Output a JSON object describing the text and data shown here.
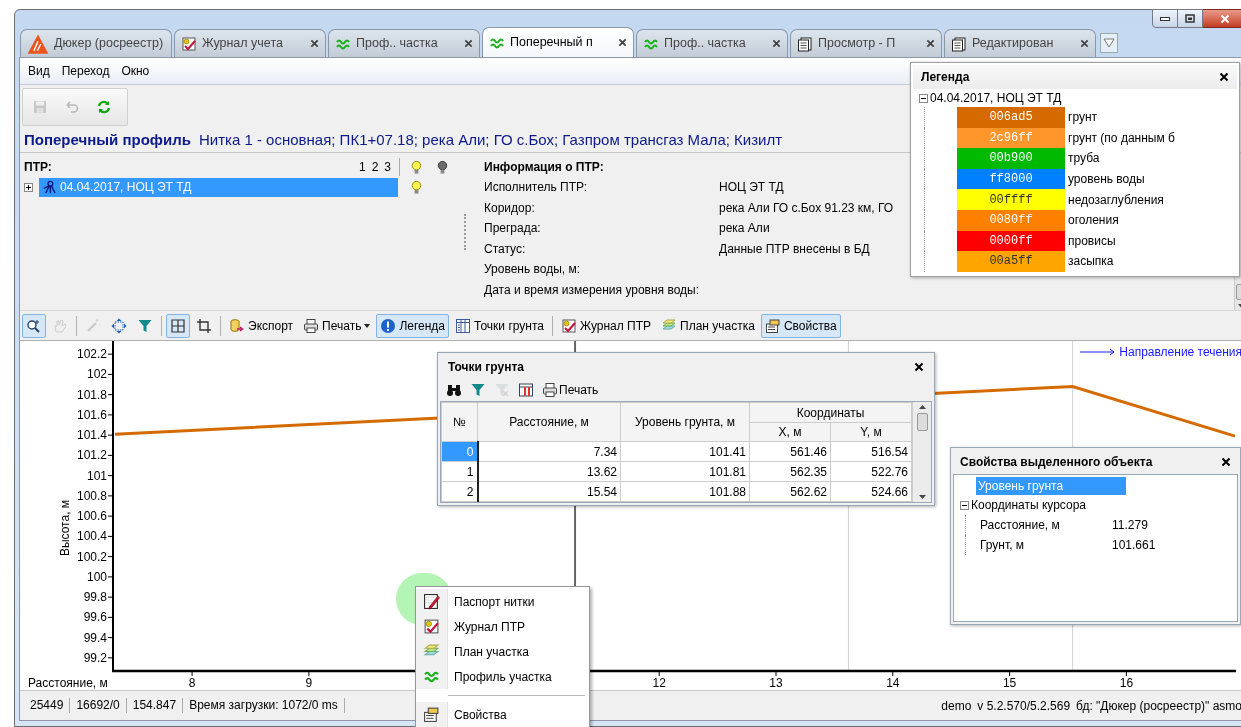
{
  "tabs": [
    {
      "label": "Дюкер (росреестр)",
      "kind": "logo",
      "closable": false,
      "selected": false
    },
    {
      "label": "Журнал учета",
      "kind": "journal",
      "closable": true,
      "selected": false
    },
    {
      "label": "Проф.. частка",
      "kind": "profile",
      "closable": true,
      "selected": false
    },
    {
      "label": "Поперечный п",
      "kind": "profile",
      "closable": true,
      "selected": true
    },
    {
      "label": "Проф.. частка",
      "kind": "profile",
      "closable": true,
      "selected": false
    },
    {
      "label": "Просмотр - П",
      "kind": "document",
      "closable": true,
      "selected": false
    },
    {
      "label": "Редактирован",
      "kind": "document",
      "closable": true,
      "selected": false
    }
  ],
  "menu": [
    "Вид",
    "Переход",
    "Окно"
  ],
  "toolbar": [
    {
      "disabled": true
    },
    {
      "disabled": true
    },
    {
      "disabled": false
    }
  ],
  "heading": {
    "title": "Поперечный профиль",
    "details": "Нитка 1 - основная; ПК1+07.18; река Али; ГО с.Бох; Газпром трансгаз Мала; Кизилт"
  },
  "ptr": {
    "label": "ПТР:",
    "levels": [
      "1",
      "2",
      "3"
    ],
    "tree": [
      {
        "label": "04.04.2017, НОЦ ЭТ ТД",
        "expanded": false,
        "selected": true,
        "visible": true
      }
    ]
  },
  "info": {
    "title": "Информация о ПТР:",
    "rows": [
      {
        "label": "Исполнитель ПТР:",
        "value": "НОЦ ЭТ ТД"
      },
      {
        "label": "Коридор:",
        "value": "река Али ГО с.Бох 91.23 км, ГО"
      },
      {
        "label": "Преграда:",
        "value": "река Али"
      },
      {
        "label": "Статус:",
        "value": "Данные ПТР внесены в БД"
      },
      {
        "label": "Уровень воды, м:"
      },
      {
        "label": "Дата и время измерения уровня воды:"
      }
    ]
  },
  "chart_toolbar": [
    {
      "kind": "button",
      "pressed": true,
      "disabled": false
    },
    {
      "kind": "button",
      "pressed": false,
      "disabled": true
    },
    {
      "kind": "separator"
    },
    {
      "kind": "button",
      "pressed": false,
      "disabled": true
    },
    {
      "kind": "button",
      "pressed": false,
      "disabled": false
    },
    {
      "kind": "button",
      "pressed": false,
      "disabled": false
    },
    {
      "kind": "separator"
    },
    {
      "kind": "button",
      "pressed": true,
      "disabled": false
    },
    {
      "kind": "button",
      "pressed": false,
      "disabled": false
    },
    {
      "kind": "separator"
    },
    {
      "kind": "button",
      "label": "Экспорт",
      "pressed": false,
      "disabled": false
    },
    {
      "kind": "dropdown",
      "label": "Печать",
      "pressed": false,
      "disabled": false
    },
    {
      "kind": "button",
      "label": "Легенда",
      "pressed": true,
      "disabled": false
    },
    {
      "kind": "button",
      "label": "Точки грунта",
      "pressed": false,
      "disabled": false
    },
    {
      "kind": "separator"
    },
    {
      "kind": "button",
      "label": "Журнал ПТР",
      "pressed": false,
      "disabled": false
    },
    {
      "kind": "button",
      "label": "План участка",
      "pressed": false,
      "disabled": false
    },
    {
      "kind": "button",
      "label": "Свойства",
      "pressed": true,
      "disabled": false
    }
  ],
  "chart": {
    "flow_legend": "Направление течения",
    "chart_data": {
      "type": "line",
      "xlabel": "Расстояние, м",
      "ylabel": "Высота, м",
      "x": [
        7.34,
        15.54,
        16.93
      ],
      "series": [
        {
          "color": "#d56a00",
          "values": [
            101.41,
            101.88,
            101.39
          ]
        }
      ],
      "xlim": [
        7.34,
        16.93
      ],
      "ylim": [
        99.08,
        102.33
      ],
      "xticks": [
        8,
        9,
        12,
        13,
        14,
        15,
        16
      ],
      "yticks": [
        99.2,
        99.4,
        99.6,
        99.8,
        100,
        100.2,
        100.4,
        100.6,
        100.8,
        101,
        101.2,
        101.4,
        101.6,
        101.8,
        102,
        102.2
      ],
      "ref_lines": [
        {
          "axis": "x",
          "value": 11.279
        },
        {
          "axis": "x",
          "value": 13.62
        },
        {
          "axis": "x",
          "value": 15.54
        }
      ]
    }
  },
  "legend": {
    "title": "Легенда",
    "root": {
      "label": "04.04.2017, НОЦ ЭТ ТД",
      "expanded": true,
      "items": [
        {
          "code": "006ad5",
          "label": "грунт",
          "color": "#d56a00"
        },
        {
          "code": "2c96ff",
          "label": "грунт (по данным б",
          "color": "#ff962c"
        },
        {
          "code": "00b900",
          "label": "труба",
          "color": "#00b900"
        },
        {
          "code": "ff8000",
          "label": "уровень воды",
          "color": "#0080ff"
        },
        {
          "code": "00ffff",
          "label": "недозаглубления",
          "color": "#ffff00"
        },
        {
          "code": "0080ff",
          "label": "оголения",
          "color": "#ff8000"
        },
        {
          "code": "0000ff",
          "label": "провисы",
          "color": "#ff0000"
        },
        {
          "code": "00a5ff",
          "label": "засыпка",
          "color": "#ffa500"
        }
      ]
    }
  },
  "points": {
    "title": "Точки грунта",
    "toolbar": [
      {
        "disabled": false
      },
      {
        "disabled": false
      },
      {
        "disabled": true
      },
      {
        "disabled": false
      },
      {
        "label": "Печать",
        "disabled": false
      }
    ],
    "columns": [
      "№",
      "Расстояние, м",
      "Уровень грунта, м"
    ],
    "group": {
      "label": "Координаты",
      "columns": [
        "X, м",
        "Y, м"
      ]
    },
    "rows": [
      {
        "cells": [
          "0",
          "7.34",
          "101.41",
          "561.46",
          "516.54"
        ],
        "selected": true
      },
      {
        "cells": [
          "1",
          "13.62",
          "101.81",
          "562.35",
          "522.76"
        ],
        "selected": false
      },
      {
        "cells": [
          "2",
          "15.54",
          "101.88",
          "562.62",
          "524.66"
        ],
        "selected": false
      }
    ]
  },
  "properties": {
    "title": "Свойства выделенного объекта",
    "items": [
      {
        "label": "Уровень грунта",
        "selected": true
      }
    ],
    "group": {
      "label": "Координаты курсора",
      "expanded": true,
      "children": [
        {
          "label": "Расстояние, м",
          "value": "11.279"
        },
        {
          "label": "Грунт, м",
          "value": "101.661"
        }
      ]
    }
  },
  "context_menu": {
    "items": [
      {
        "kind": "item",
        "label": "Паспорт нитки"
      },
      {
        "kind": "item",
        "label": "Журнал ПТР"
      },
      {
        "kind": "item",
        "label": "План участка"
      },
      {
        "kind": "item",
        "label": "Профиль участка"
      },
      {
        "kind": "separator"
      },
      {
        "kind": "item",
        "label": "Свойства"
      }
    ]
  },
  "status_bar": {
    "cells": [
      "25449",
      "16692/0",
      "154.847",
      "Время загрузки: 1072/0 ms"
    ],
    "right": [
      "demo",
      "v 5.2.570/5.2.569",
      "бд: \"Дюкер (росреестр)\" asmo"
    ]
  }
}
